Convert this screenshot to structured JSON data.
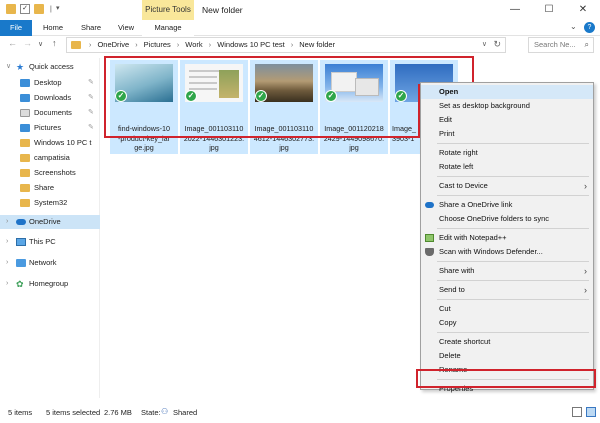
{
  "window": {
    "title": "New folder",
    "contextual_tab_group": "Picture Tools"
  },
  "ribbon": {
    "tabs": [
      "File",
      "Home",
      "Share",
      "View",
      "Manage"
    ]
  },
  "address": {
    "breadcrumbs": [
      "OneDrive",
      "Pictures",
      "Work",
      "Windows 10 PC test",
      "New folder"
    ],
    "search_placeholder": "Search Ne..."
  },
  "nav": {
    "quick_access": "Quick access",
    "pinned": [
      "Desktop",
      "Downloads",
      "Documents",
      "Pictures"
    ],
    "folders": [
      "Windows 10 PC t",
      "campatisia",
      "Screenshots",
      "Share",
      "System32"
    ],
    "onedrive": "OneDrive",
    "this_pc": "This PC",
    "network": "Network",
    "homegroup": "Homegroup"
  },
  "files": [
    {
      "name": "find-windows-10-product-key_large.jpg",
      "label": "find-windows-10\n-product-key_lar\nge.jpg",
      "thumb": "windows"
    },
    {
      "name": "Image_0011031102022-1446301223.jpg",
      "label": "Image_001103110\n2022-1446301223.\njpg",
      "thumb": "document"
    },
    {
      "name": "Image_0011031104612-1446302773.jpg",
      "label": "Image_001103110\n4612-1446302773.\njpg",
      "thumb": "landscape"
    },
    {
      "name": "Image_0011202182429-1449098670.jpg",
      "label": "Image_001120218\n2429-1449098670.\njpg",
      "thumb": "desktop"
    },
    {
      "name": "Image_...3903-1...",
      "label": "Image_\n3903-1",
      "thumb": "desktop2"
    }
  ],
  "context_menu": {
    "items": [
      {
        "label": "Open",
        "bold": true,
        "hover": true
      },
      {
        "label": "Set as desktop background"
      },
      {
        "label": "Edit"
      },
      {
        "label": "Print"
      },
      {
        "sep": true
      },
      {
        "label": "Rotate right"
      },
      {
        "label": "Rotate left"
      },
      {
        "sep": true
      },
      {
        "label": "Cast to Device",
        "submenu": true
      },
      {
        "sep": true
      },
      {
        "label": "Share a OneDrive link",
        "icon": "onedrive-icon"
      },
      {
        "label": "Choose OneDrive folders to sync"
      },
      {
        "sep": true
      },
      {
        "label": "Edit with Notepad++",
        "icon": "notepad-icon"
      },
      {
        "label": "Scan with Windows Defender...",
        "icon": "defender-icon"
      },
      {
        "sep": true
      },
      {
        "label": "Share with",
        "submenu": true
      },
      {
        "sep": true
      },
      {
        "label": "Send to",
        "submenu": true
      },
      {
        "sep": true
      },
      {
        "label": "Cut"
      },
      {
        "label": "Copy"
      },
      {
        "sep": true
      },
      {
        "label": "Create shortcut"
      },
      {
        "label": "Delete"
      },
      {
        "label": "Rename"
      },
      {
        "sep": true
      },
      {
        "label": "Properties"
      }
    ]
  },
  "status": {
    "item_count": "5 items",
    "selected": "5 items selected",
    "size": "2.76 MB",
    "state_label": "State:",
    "state_value": "Shared"
  },
  "colors": {
    "accent": "#1979ca",
    "selection": "#cce8ff",
    "highlight_box": "#d0232c",
    "contextual_tab": "#f9e79a"
  }
}
